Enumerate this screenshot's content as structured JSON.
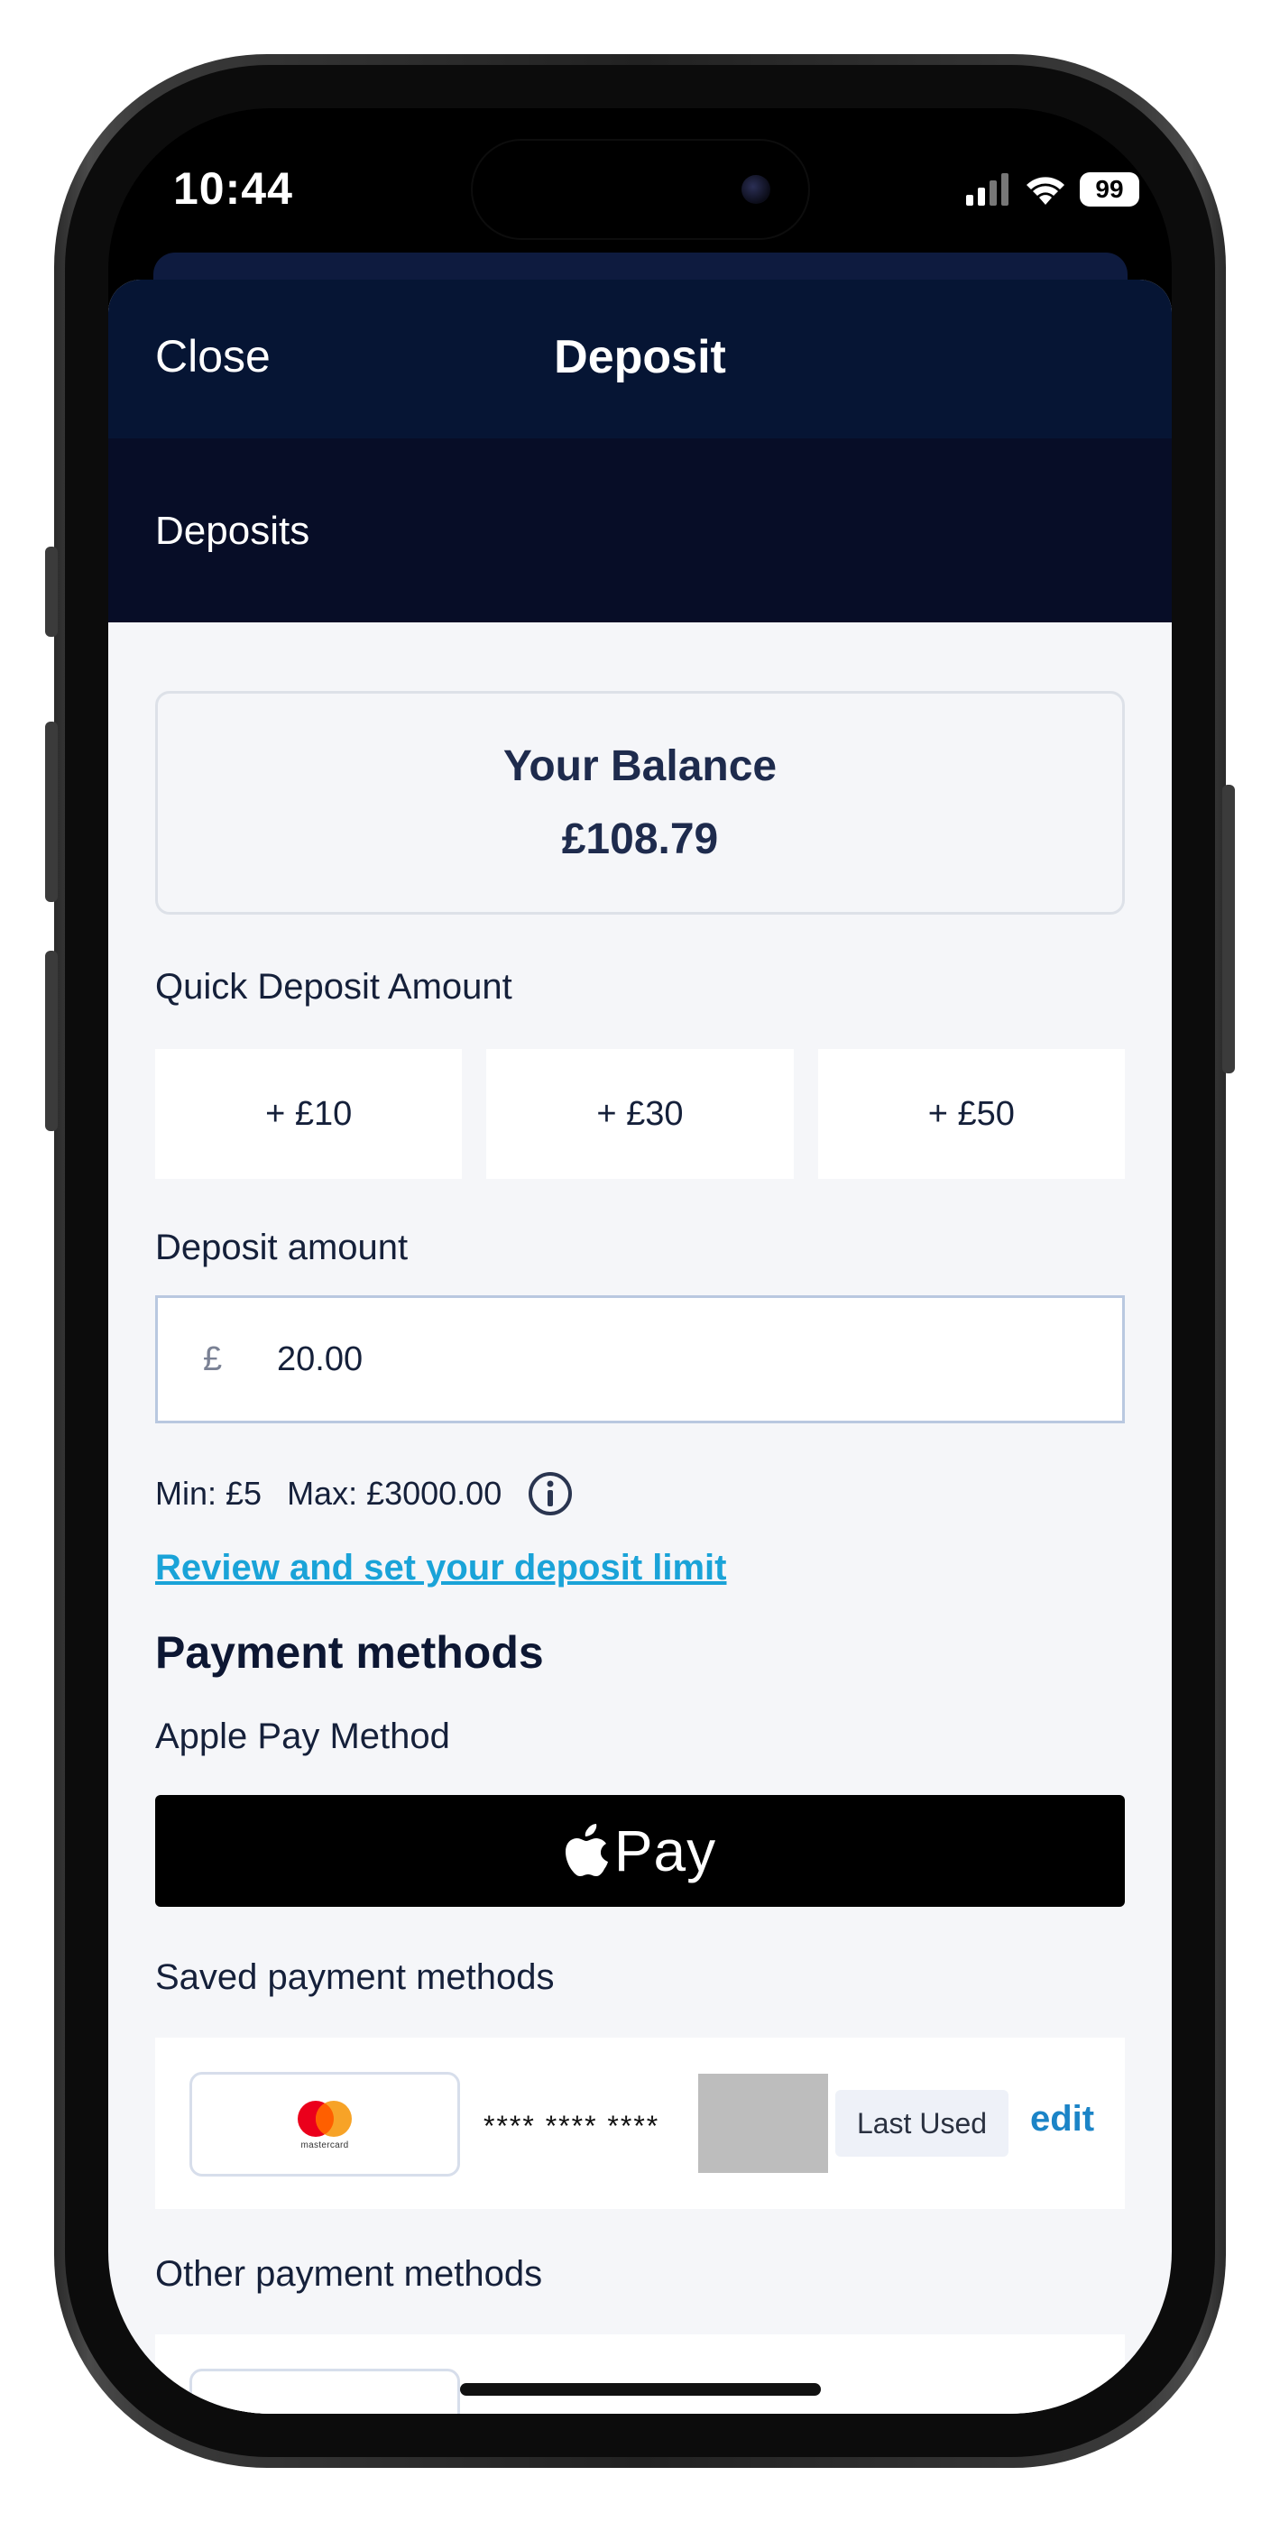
{
  "status_bar": {
    "time": "10:44",
    "battery": "99",
    "icons": [
      "cellular-signal-icon",
      "wifi-icon",
      "battery-icon"
    ]
  },
  "header": {
    "close_label": "Close",
    "title": "Deposit"
  },
  "subheader": {
    "title": "Deposits"
  },
  "balance": {
    "label": "Your Balance",
    "value": "£108.79"
  },
  "quick_deposit": {
    "label": "Quick Deposit Amount",
    "options": [
      "+ £10",
      "+ £30",
      "+ £50"
    ]
  },
  "deposit_amount": {
    "label": "Deposit amount",
    "currency_symbol": "£",
    "value": "20.00"
  },
  "limits": {
    "min": "Min: £5",
    "max": "Max: £3000.00",
    "link": "Review and set your deposit limit"
  },
  "payment_methods": {
    "title": "Payment methods",
    "apple_pay_label": "Apple Pay Method",
    "apple_pay_button": "Pay",
    "saved_label": "Saved payment methods",
    "saved_card": {
      "brand": "mastercard",
      "masked_number": "**** **** ****",
      "badge": "Last Used",
      "edit_label": "edit"
    },
    "other_label": "Other payment methods"
  },
  "colors": {
    "header_bg": "#061534",
    "subheader_bg": "#070d27",
    "link": "#1aa3d8",
    "edit": "#1b84c7",
    "mastercard_red": "#eb001b",
    "mastercard_orange": "#f79e1b"
  }
}
